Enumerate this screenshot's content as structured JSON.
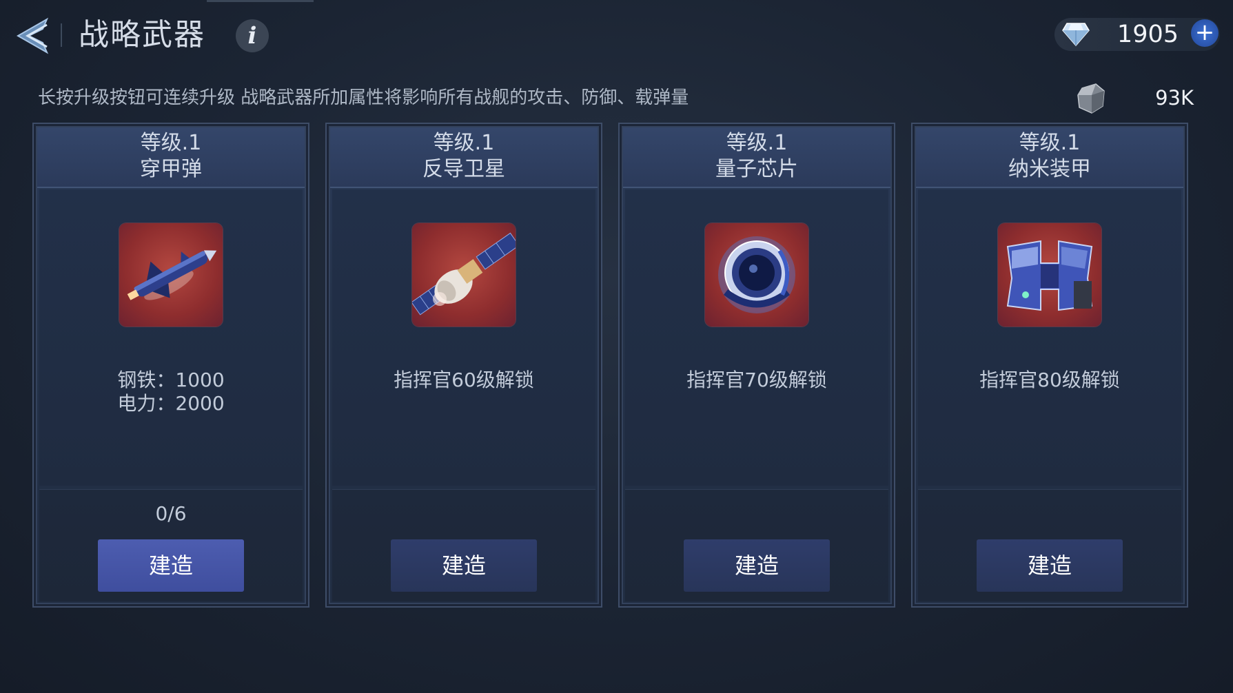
{
  "header": {
    "title": "战略武器",
    "info_label": "i",
    "gems": "1905",
    "gem_add": "+",
    "ore": "93K"
  },
  "hint": "长按升级按钮可连续升级 战略武器所加属性将影响所有战舰的攻击、防御、载弹量",
  "cards": [
    {
      "level": "等级.1",
      "name": "穿甲弹",
      "icon": "armor-piercing-missile-icon",
      "resources": [
        {
          "label": "钢铁：",
          "value": "1000"
        },
        {
          "label": "电力：",
          "value": "2000"
        }
      ],
      "progress": "0/6",
      "button": "建造"
    },
    {
      "level": "等级.1",
      "name": "反导卫星",
      "icon": "satellite-icon",
      "unlock": "指挥官60级解锁",
      "button": "建造"
    },
    {
      "level": "等级.1",
      "name": "量子芯片",
      "icon": "quantum-chip-icon",
      "unlock": "指挥官70级解锁",
      "button": "建造"
    },
    {
      "level": "等级.1",
      "name": "纳米装甲",
      "icon": "nano-armor-icon",
      "unlock": "指挥官80级解锁",
      "button": "建造"
    }
  ]
}
